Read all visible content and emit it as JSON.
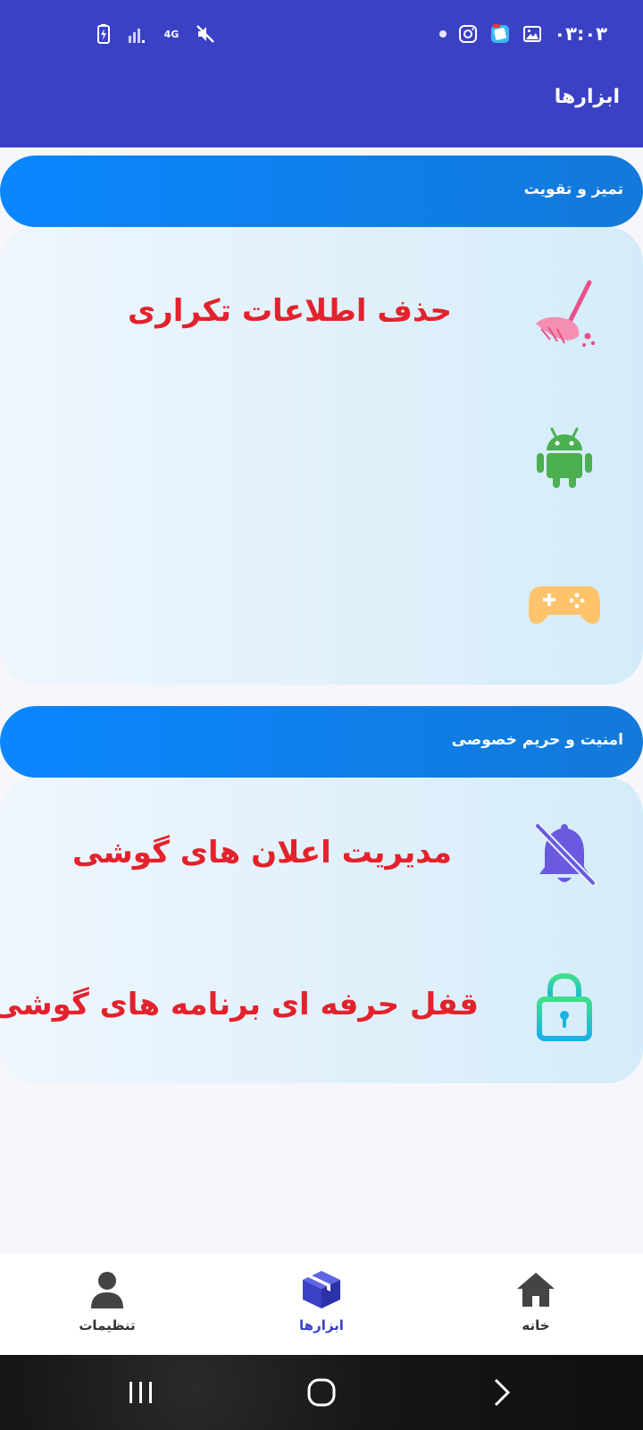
{
  "status_bar": {
    "time": "۰۳:۰۳",
    "network": "4G"
  },
  "header": {
    "title": "ابزارها"
  },
  "sections": [
    {
      "title": "تمیز و تقویت",
      "items": [
        {
          "label": "حذف اطلاعات تکراری",
          "icon": "broom-icon",
          "icon_color": "#e94f8a"
        },
        {
          "label": "",
          "icon": "android-icon",
          "icon_color": "#4caf50"
        },
        {
          "label": "",
          "icon": "gamepad-icon",
          "icon_color": "#ffc46b"
        }
      ]
    },
    {
      "title": "امنیت و حریم خصوصی",
      "items": [
        {
          "label": "مدیریت اعلان های گوشی",
          "icon": "bell-off-icon",
          "icon_color": "#6a5ae0"
        },
        {
          "label": "قفل حرفه ای برنامه های گوشی",
          "icon": "lock-icon",
          "icon_color": "#1fc6d6"
        }
      ]
    }
  ],
  "bottom_nav": {
    "items": [
      {
        "label": "تنظیمات",
        "icon": "person-icon"
      },
      {
        "label": "ابزارها",
        "icon": "box-icon",
        "active": true
      },
      {
        "label": "خانه",
        "icon": "home-icon"
      }
    ]
  },
  "colors": {
    "header_bg": "#3b41c5",
    "accent": "#0a86ff",
    "item_text": "#e3222c"
  }
}
